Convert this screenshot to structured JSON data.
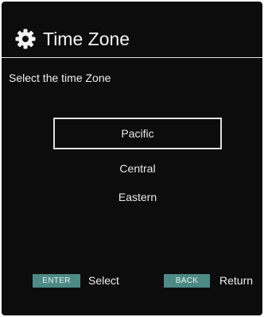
{
  "header": {
    "icon": "gear-icon",
    "title": "Time Zone"
  },
  "subtitle": "Select the time Zone",
  "options": [
    {
      "label": "Pacific",
      "selected": true
    },
    {
      "label": "Central",
      "selected": false
    },
    {
      "label": "Eastern",
      "selected": false
    }
  ],
  "footer": {
    "enter_key": "ENTER",
    "enter_action": "Select",
    "back_key": "BACK",
    "back_action": "Return"
  },
  "colors": {
    "background": "#0c0c0c",
    "text": "#f0f0f0",
    "key_badge": "#4d8a86",
    "selection_border": "#e0e0e0"
  }
}
